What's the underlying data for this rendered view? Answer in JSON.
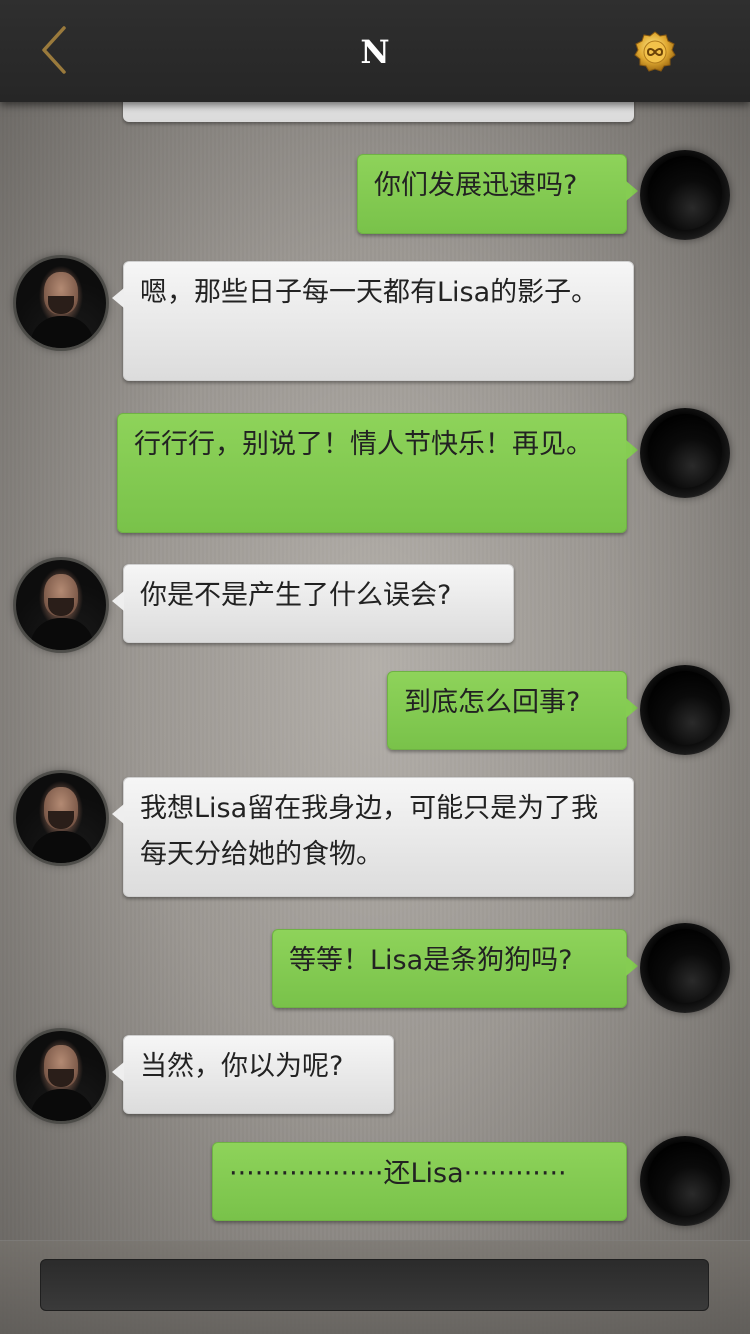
{
  "header": {
    "title": "N",
    "back_icon": "chevron-left-icon",
    "coin_icon": "infinity-coin-icon",
    "accent_color": "#b08a3a"
  },
  "messages": [
    {
      "sender": "me",
      "text": "你们发展迅速吗?"
    },
    {
      "sender": "other",
      "text": "嗯，那些日子每一天都有Lisa的影子。"
    },
    {
      "sender": "me",
      "text": "行行行，别说了！情人节快乐！再见。"
    },
    {
      "sender": "other",
      "text": "你是不是产生了什么误会?"
    },
    {
      "sender": "me",
      "text": "到底怎么回事?"
    },
    {
      "sender": "other",
      "text": "我想Lisa留在我身边，可能只是为了我每天分给她的食物。"
    },
    {
      "sender": "me",
      "text": "等等！Lisa是条狗狗吗?"
    },
    {
      "sender": "other",
      "text": "当然，你以为呢?"
    },
    {
      "sender": "me",
      "text": "··················还Lisa············"
    }
  ],
  "colors": {
    "my_bubble": "#86cc55",
    "other_bubble": "#eeeeee",
    "topbar": "#2b2b2b"
  },
  "input": {
    "placeholder": ""
  }
}
